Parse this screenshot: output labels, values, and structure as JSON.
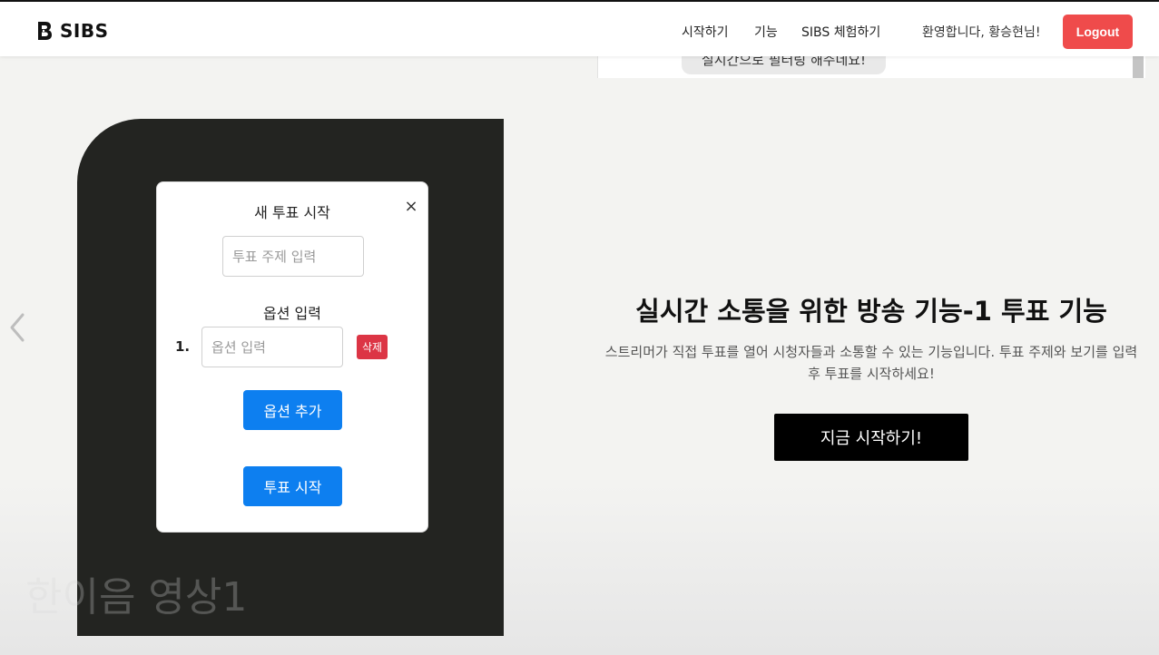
{
  "navbar": {
    "brand": "SIBS",
    "brand_icon": "b-logo-icon",
    "links": [
      "시작하기",
      "기능",
      "SIBS 체험하기"
    ],
    "welcome": "환영합니다, 황승현님!",
    "logout_label": "Logout"
  },
  "chat": {
    "partial_message": "실시간으로 필터링 해주네요!"
  },
  "carousel": {
    "prev_icon": "chevron-left-icon"
  },
  "video": {
    "caption": "한이음 영상1"
  },
  "poll_modal": {
    "title": "새 투표 시작",
    "close_label": "×",
    "topic_placeholder": "투표 주제 입력",
    "option_heading": "옵션 입력",
    "option_number": "1.",
    "option_placeholder": "옵션 입력",
    "delete_label": "삭제",
    "add_option_label": "옵션 추가",
    "start_poll_label": "투표 시작"
  },
  "feature": {
    "title": "실시간 소통을 위한 방송 기능-1 투표 기능",
    "description": "스트리머가 직접 투표를 열어 시청자들과 소통할 수 있는 기능입니다. 투표 주제와 보기를 입력 후 투표를 시작하세요!",
    "cta_label": "지금 시작하기!"
  },
  "colors": {
    "logout": "#ef4b4b",
    "primary_blue": "#0d7ff0",
    "danger": "#dc3545",
    "cta": "#000000",
    "video_bg": "#232421"
  }
}
